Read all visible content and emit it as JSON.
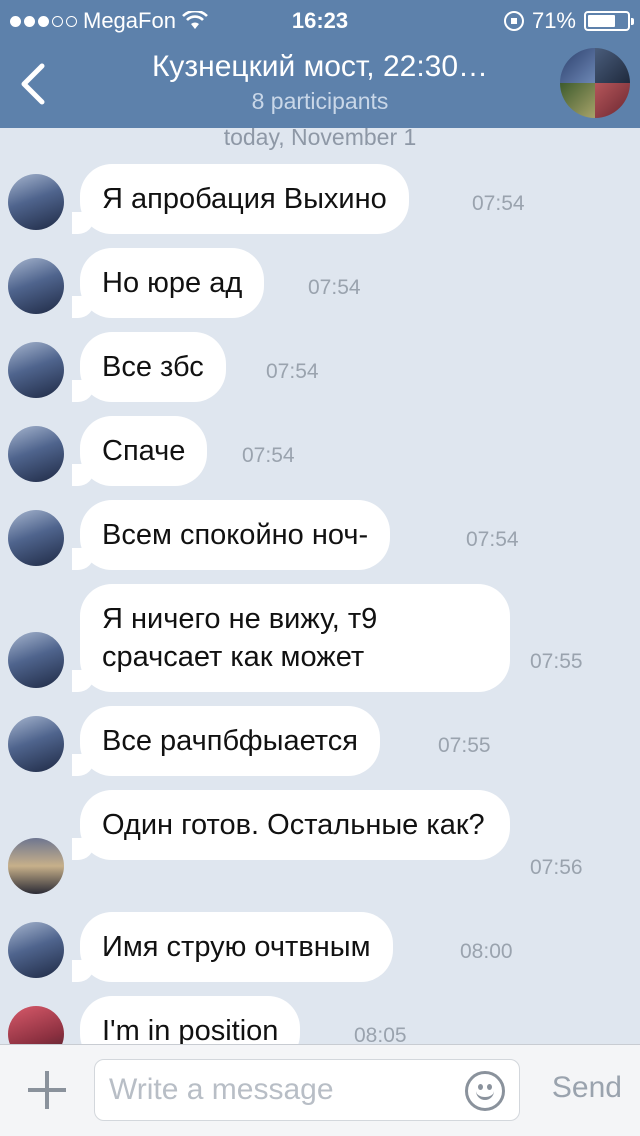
{
  "status_bar": {
    "carrier": "MegaFon",
    "time": "16:23",
    "battery": "71%",
    "battery_level": 0.71,
    "signal_bars": 3
  },
  "header": {
    "back_icon": "chevron-left-icon",
    "title": "Кузнецкий мост, 22:30…",
    "subtitle": "8 participants"
  },
  "date_separator": "today, November 1",
  "messages": [
    {
      "text": "Я апробация Выхино",
      "time": "07:54",
      "avatar": "city"
    },
    {
      "text": "Но юре ад",
      "time": "07:54",
      "avatar": "city"
    },
    {
      "text": "Все збс",
      "time": "07:54",
      "avatar": "city"
    },
    {
      "text": "Спаче",
      "time": "07:54",
      "avatar": "city"
    },
    {
      "text": "Всем спокойно ноч-",
      "time": "07:54",
      "avatar": "city"
    },
    {
      "text": "Я ничего не вижу, т9 срачсает как может",
      "time": "07:55",
      "avatar": "city"
    },
    {
      "text": "Все рачпбфыается",
      "time": "07:55",
      "avatar": "city"
    },
    {
      "text": "Один готов. Остальные как?",
      "time": "07:56",
      "avatar": "sunset"
    },
    {
      "text": "Имя струю очтвным",
      "time": "08:00",
      "avatar": "city"
    },
    {
      "text": "I'm in position",
      "time": "08:05",
      "avatar": "red"
    }
  ],
  "input": {
    "placeholder": "Write a message",
    "value": "",
    "send_label": "Send"
  },
  "colors": {
    "header": "#5d81ab",
    "background": "#dfe6ef",
    "bubble": "#ffffff"
  }
}
